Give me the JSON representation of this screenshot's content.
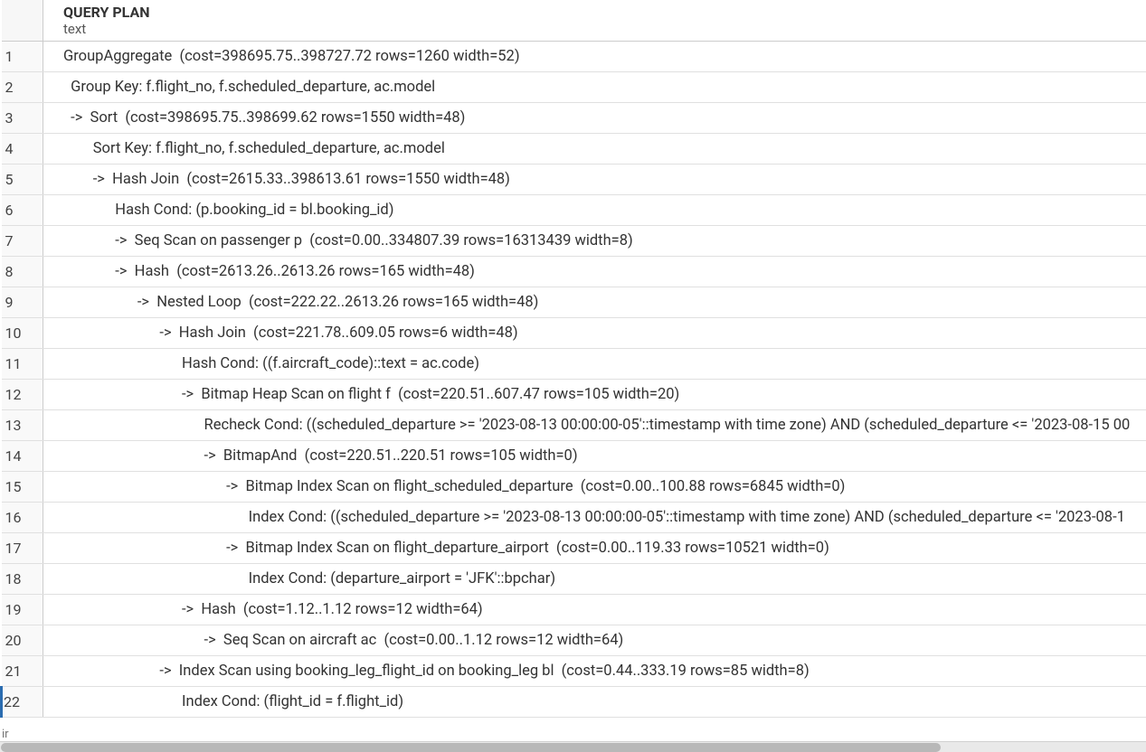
{
  "header": {
    "column_title": "QUERY PLAN",
    "column_subtype": "text"
  },
  "rows": [
    {
      "n": "1",
      "text": "GroupAggregate  (cost=398695.75..398727.72 rows=1260 width=52)"
    },
    {
      "n": "2",
      "text": "  Group Key: f.flight_no, f.scheduled_departure, ac.model"
    },
    {
      "n": "3",
      "text": "  ->  Sort  (cost=398695.75..398699.62 rows=1550 width=48)"
    },
    {
      "n": "4",
      "text": "        Sort Key: f.flight_no, f.scheduled_departure, ac.model"
    },
    {
      "n": "5",
      "text": "        ->  Hash Join  (cost=2615.33..398613.61 rows=1550 width=48)"
    },
    {
      "n": "6",
      "text": "              Hash Cond: (p.booking_id = bl.booking_id)"
    },
    {
      "n": "7",
      "text": "              ->  Seq Scan on passenger p  (cost=0.00..334807.39 rows=16313439 width=8)"
    },
    {
      "n": "8",
      "text": "              ->  Hash  (cost=2613.26..2613.26 rows=165 width=48)"
    },
    {
      "n": "9",
      "text": "                    ->  Nested Loop  (cost=222.22..2613.26 rows=165 width=48)"
    },
    {
      "n": "10",
      "text": "                          ->  Hash Join  (cost=221.78..609.05 rows=6 width=48)"
    },
    {
      "n": "11",
      "text": "                                Hash Cond: ((f.aircraft_code)::text = ac.code)"
    },
    {
      "n": "12",
      "text": "                                ->  Bitmap Heap Scan on flight f  (cost=220.51..607.47 rows=105 width=20)"
    },
    {
      "n": "13",
      "text": "                                      Recheck Cond: ((scheduled_departure >= '2023-08-13 00:00:00-05'::timestamp with time zone) AND (scheduled_departure <= '2023-08-15 00"
    },
    {
      "n": "14",
      "text": "                                      ->  BitmapAnd  (cost=220.51..220.51 rows=105 width=0)"
    },
    {
      "n": "15",
      "text": "                                            ->  Bitmap Index Scan on flight_scheduled_departure  (cost=0.00..100.88 rows=6845 width=0)"
    },
    {
      "n": "16",
      "text": "                                                  Index Cond: ((scheduled_departure >= '2023-08-13 00:00:00-05'::timestamp with time zone) AND (scheduled_departure <= '2023-08-1"
    },
    {
      "n": "17",
      "text": "                                            ->  Bitmap Index Scan on flight_departure_airport  (cost=0.00..119.33 rows=10521 width=0)"
    },
    {
      "n": "18",
      "text": "                                                  Index Cond: (departure_airport = 'JFK'::bpchar)"
    },
    {
      "n": "19",
      "text": "                                ->  Hash  (cost=1.12..1.12 rows=12 width=64)"
    },
    {
      "n": "20",
      "text": "                                      ->  Seq Scan on aircraft ac  (cost=0.00..1.12 rows=12 width=64)"
    },
    {
      "n": "21",
      "text": "                          ->  Index Scan using booking_leg_flight_id on booking_leg bl  (cost=0.44..333.19 rows=85 width=8)"
    },
    {
      "n": "22",
      "text": "                                Index Cond: (flight_id = f.flight_id)"
    }
  ],
  "selected_row": "22",
  "status_text": "ir"
}
